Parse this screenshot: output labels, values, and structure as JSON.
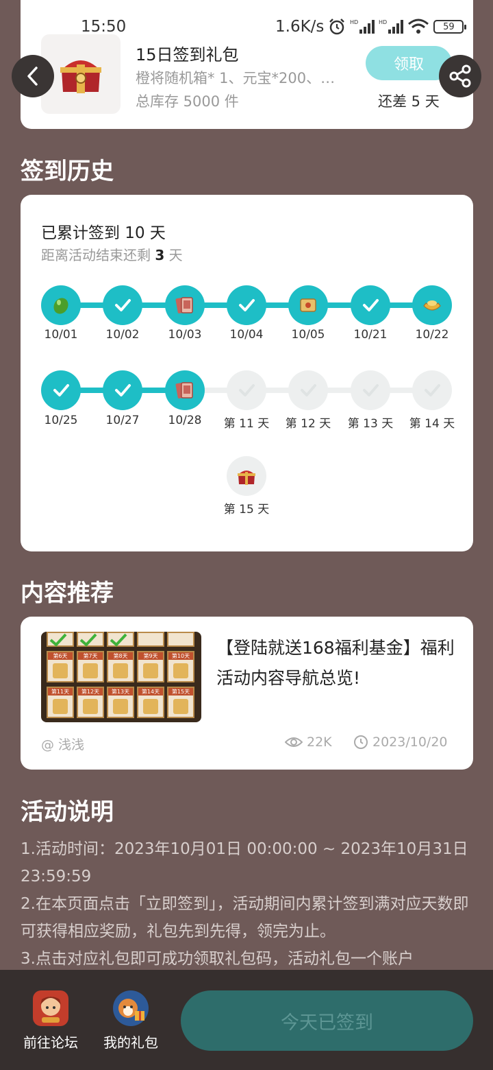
{
  "status_bar": {
    "time": "15:50",
    "network_speed": "1.6K/s",
    "battery": "59"
  },
  "gift": {
    "title": "15日签到礼包",
    "description": "橙将随机箱* 1、元宝*200、…",
    "stock": "总库存 5000 件",
    "claim_label": "领取",
    "remaining": "还差 5 天"
  },
  "history": {
    "section_title": "签到历史",
    "total": "已累计签到 10 天",
    "remain_prefix": "距离活动结束还剩",
    "remain_days": "3",
    "remain_suffix": "天",
    "days": [
      {
        "label": "10/01",
        "state": "done",
        "icon": "green-egg-icon"
      },
      {
        "label": "10/02",
        "state": "done",
        "icon": "check-icon"
      },
      {
        "label": "10/03",
        "state": "done",
        "icon": "card-icon"
      },
      {
        "label": "10/04",
        "state": "done",
        "icon": "check-icon"
      },
      {
        "label": "10/05",
        "state": "done",
        "icon": "scroll-icon"
      },
      {
        "label": "10/21",
        "state": "done",
        "icon": "check-icon"
      },
      {
        "label": "10/22",
        "state": "done",
        "icon": "gold-ingot-icon"
      },
      {
        "label": "10/25",
        "state": "done",
        "icon": "check-icon"
      },
      {
        "label": "10/27",
        "state": "done",
        "icon": "check-icon"
      },
      {
        "label": "10/28",
        "state": "done",
        "icon": "card-icon"
      },
      {
        "label": "第 11 天",
        "state": "pending",
        "icon": "check-icon"
      },
      {
        "label": "第 12 天",
        "state": "pending",
        "icon": "check-icon"
      },
      {
        "label": "第 13 天",
        "state": "pending",
        "icon": "check-icon"
      },
      {
        "label": "第 14 天",
        "state": "pending",
        "icon": "check-icon"
      },
      {
        "label": "第 15 天",
        "state": "pending",
        "icon": "treasure-chest-icon"
      }
    ]
  },
  "recommend": {
    "section_title": "内容推荐",
    "title": "【登陆就送168福利基金】福利活动内容导航总览!",
    "author": "@ 浅浅",
    "views": "22K",
    "date": "2023/10/20",
    "thumb_labels": [
      "第6天",
      "第7天",
      "第8天",
      "第9天",
      "第10天",
      "第11天",
      "第12天",
      "第13天",
      "第14天",
      "第15天"
    ]
  },
  "rules": {
    "section_title": "活动说明",
    "lines": [
      "1.活动时间：2023年10月01日 00:00:00 ~ 2023年10月31日 23:59:59",
      "2.在本页面点击「立即签到」，活动期间内累计签到满对应天数即可获得相应奖励，礼包先到先得，领完为止。",
      "3.点击对应礼包即可成功领取礼包码，活动礼包一个账户"
    ]
  },
  "bottom": {
    "forum_label": "前往论坛",
    "my_gifts_label": "我的礼包",
    "signed_label": "今天已签到"
  },
  "colors": {
    "background": "#6f5a58",
    "accent": "#1ebec6",
    "claim": "#8fe0e2",
    "signed_button": "#2e6d6b"
  }
}
